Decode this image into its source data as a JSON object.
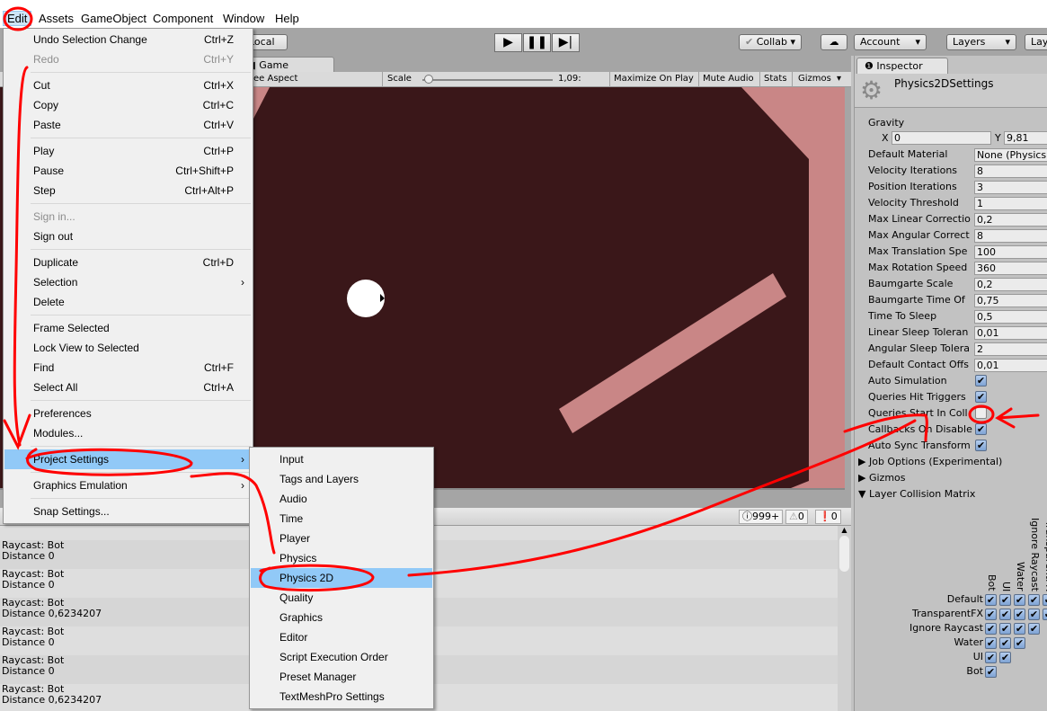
{
  "menubar": [
    "Edit",
    "Assets",
    "GameObject",
    "Component",
    "Window",
    "Help"
  ],
  "toolbar": {
    "local": "Local",
    "collab": "Collab",
    "account": "Account",
    "layers": "Layers",
    "layout": "Lay"
  },
  "game_tab": "Game",
  "gamebar": {
    "aspect": "ee Aspect",
    "scale_label": "Scale",
    "scale_value": "1,09:",
    "maximize": "Maximize On Play",
    "mute": "Mute Audio",
    "stats": "Stats",
    "gizmos": "Gizmos"
  },
  "console": {
    "log_count": "999+",
    "warn_count": "0",
    "error_count": "0",
    "rows": [
      {
        "title": "",
        "detail": "Distance 0,6234207"
      },
      {
        "title": "Raycast: Bot",
        "detail": "Distance 0"
      },
      {
        "title": "Raycast: Bot",
        "detail": "Distance 0"
      },
      {
        "title": "Raycast: Bot",
        "detail": "Distance 0,6234207"
      },
      {
        "title": "Raycast: Bot",
        "detail": "Distance 0"
      },
      {
        "title": "Raycast: Bot",
        "detail": "Distance 0"
      },
      {
        "title": "Raycast: Bot",
        "detail": "Distance 0,6234207"
      }
    ]
  },
  "inspector": {
    "tab": "Inspector",
    "title": "Physics2DSettings",
    "gravity_label": "Gravity",
    "gravity_x": "0",
    "gravity_y": "9,81",
    "fields": [
      {
        "label": "Default Material",
        "value": "None (Physics"
      },
      {
        "label": "Velocity Iterations",
        "value": "8"
      },
      {
        "label": "Position Iterations",
        "value": "3"
      },
      {
        "label": "Velocity Threshold",
        "value": "1"
      },
      {
        "label": "Max Linear Correctio",
        "value": "0,2"
      },
      {
        "label": "Max Angular Correct",
        "value": "8"
      },
      {
        "label": "Max Translation Spe",
        "value": "100"
      },
      {
        "label": "Max Rotation Speed",
        "value": "360"
      },
      {
        "label": "Baumgarte Scale",
        "value": "0,2"
      },
      {
        "label": "Baumgarte Time Of",
        "value": "0,75"
      },
      {
        "label": "Time To Sleep",
        "value": "0,5"
      },
      {
        "label": "Linear Sleep Toleran",
        "value": "0,01"
      },
      {
        "label": "Angular Sleep Tolera",
        "value": "2"
      },
      {
        "label": "Default Contact Offs",
        "value": "0,01"
      }
    ],
    "toggles": [
      {
        "label": "Auto Simulation",
        "checked": true
      },
      {
        "label": "Queries Hit Triggers",
        "checked": true
      },
      {
        "label": "Queries Start In Coll",
        "checked": false
      },
      {
        "label": "Callbacks On Disable",
        "checked": true
      },
      {
        "label": "Auto Sync Transform",
        "checked": true
      }
    ],
    "foldouts": [
      {
        "label": "Job Options (Experimental)",
        "open": false
      },
      {
        "label": "Gizmos",
        "open": false
      },
      {
        "label": "Layer Collision Matrix",
        "open": true
      }
    ],
    "matrix_layers": [
      "Default",
      "TransparentFX",
      "Ignore Raycast",
      "Water",
      "UI",
      "Bot"
    ]
  },
  "edit_menu": [
    {
      "label": "Undo Selection Change",
      "shortcut": "Ctrl+Z"
    },
    {
      "label": "Redo",
      "shortcut": "Ctrl+Y",
      "disabled": true
    },
    {
      "sep": true
    },
    {
      "label": "Cut",
      "shortcut": "Ctrl+X"
    },
    {
      "label": "Copy",
      "shortcut": "Ctrl+C"
    },
    {
      "label": "Paste",
      "shortcut": "Ctrl+V"
    },
    {
      "sep": true
    },
    {
      "label": "Play",
      "shortcut": "Ctrl+P"
    },
    {
      "label": "Pause",
      "shortcut": "Ctrl+Shift+P"
    },
    {
      "label": "Step",
      "shortcut": "Ctrl+Alt+P"
    },
    {
      "sep": true
    },
    {
      "label": "Sign in...",
      "disabled": true
    },
    {
      "label": "Sign out"
    },
    {
      "sep": true
    },
    {
      "label": "Duplicate",
      "shortcut": "Ctrl+D"
    },
    {
      "label": "Selection",
      "submenu": true
    },
    {
      "label": "Delete"
    },
    {
      "sep": true
    },
    {
      "label": "Frame Selected"
    },
    {
      "label": "Lock View to Selected"
    },
    {
      "label": "Find",
      "shortcut": "Ctrl+F"
    },
    {
      "label": "Select All",
      "shortcut": "Ctrl+A"
    },
    {
      "sep": true
    },
    {
      "label": "Preferences"
    },
    {
      "label": "Modules..."
    },
    {
      "sep": true
    },
    {
      "label": "Project Settings",
      "submenu": true,
      "highlighted": true
    },
    {
      "sep": true
    },
    {
      "label": "Graphics Emulation",
      "submenu": true
    },
    {
      "sep": true
    },
    {
      "label": "Snap Settings..."
    }
  ],
  "project_settings_menu": [
    "Input",
    "Tags and Layers",
    "Audio",
    "Time",
    "Player",
    "Physics",
    "Physics 2D",
    "Quality",
    "Graphics",
    "Editor",
    "Script Execution Order",
    "Preset Manager",
    "TextMeshPro Settings"
  ],
  "project_settings_highlighted": "Physics 2D",
  "colors": {
    "game_bg": "#3a1719",
    "wall": "#c98686",
    "highlight": "#91c9f7",
    "annotation": "#ff0000"
  }
}
